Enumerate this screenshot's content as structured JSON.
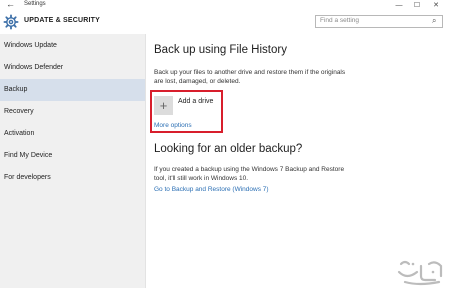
{
  "window": {
    "title": "Settings",
    "back_glyph": "←",
    "min_glyph": "—",
    "max_glyph": "☐",
    "close_glyph": "✕"
  },
  "header": {
    "title": "UPDATE & SECURITY",
    "icon": "gear-icon",
    "search_placeholder": "Find a setting"
  },
  "sidebar": {
    "items": [
      {
        "label": "Windows Update"
      },
      {
        "label": "Windows Defender"
      },
      {
        "label": "Backup"
      },
      {
        "label": "Recovery"
      },
      {
        "label": "Activation"
      },
      {
        "label": "Find My Device"
      },
      {
        "label": "For developers"
      }
    ],
    "active_index": 2,
    "active_color": "#d6dfeb"
  },
  "main": {
    "file_history": {
      "heading": "Back up using File History",
      "description_line1": "Back up your files to another drive and restore them if the originals",
      "description_line2": "are lost, damaged, or deleted.",
      "add_drive_label": "Add a drive",
      "more_options_label": "More options"
    },
    "older_backup": {
      "heading": "Looking for an older backup?",
      "description_line1": "If you created a backup using the Windows 7 Backup and Restore",
      "description_line2": "tool, it'll still work in Windows 10.",
      "link_label": "Go to Backup and Restore (Windows 7)"
    }
  },
  "colors": {
    "accent_link": "#2b6fb4",
    "highlight_border": "#d81e2c"
  }
}
